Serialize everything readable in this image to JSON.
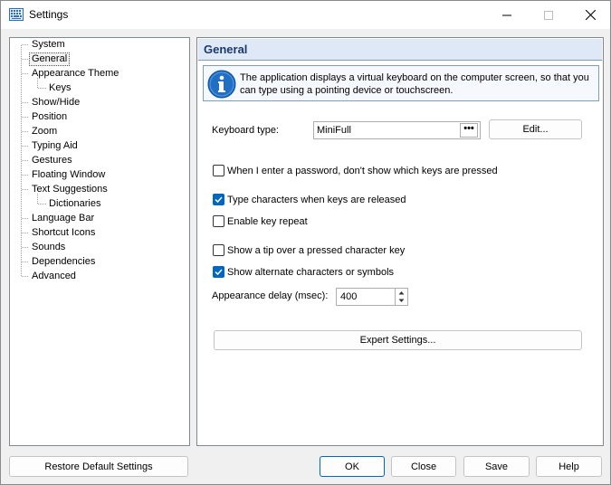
{
  "window": {
    "title": "Settings",
    "icon": "keyboard-icon"
  },
  "tree": {
    "items": [
      {
        "label": "System",
        "level": 0
      },
      {
        "label": "General",
        "level": 0,
        "selected": true
      },
      {
        "label": "Appearance Theme",
        "level": 0
      },
      {
        "label": "Keys",
        "level": 1
      },
      {
        "label": "Show/Hide",
        "level": 0
      },
      {
        "label": "Position",
        "level": 0
      },
      {
        "label": "Zoom",
        "level": 0
      },
      {
        "label": "Typing Aid",
        "level": 0
      },
      {
        "label": "Gestures",
        "level": 0
      },
      {
        "label": "Floating Window",
        "level": 0
      },
      {
        "label": "Text Suggestions",
        "level": 0
      },
      {
        "label": "Dictionaries",
        "level": 1
      },
      {
        "label": "Language Bar",
        "level": 0
      },
      {
        "label": "Shortcut Icons",
        "level": 0
      },
      {
        "label": "Sounds",
        "level": 0
      },
      {
        "label": "Dependencies",
        "level": 0
      },
      {
        "label": "Advanced",
        "level": 0
      }
    ]
  },
  "panel": {
    "title": "General",
    "info": "The application displays a virtual keyboard on the computer screen, so that you can type using a pointing device or touchscreen.",
    "keyboard_type_label": "Keyboard type:",
    "keyboard_type_value": "MiniFull",
    "dots_label": "•••",
    "edit_label": "Edit...",
    "options": [
      {
        "label": "When I enter a password, don't show which keys are pressed",
        "checked": false
      },
      {
        "label": "Type characters when keys are released",
        "checked": true
      },
      {
        "label": "Enable key repeat",
        "checked": false
      },
      {
        "label": "Show a tip over a pressed character key",
        "checked": false
      },
      {
        "label": "Show alternate characters or symbols",
        "checked": true
      }
    ],
    "delay_label": "Appearance delay (msec):",
    "delay_value": "400",
    "expert_label": "Expert Settings..."
  },
  "footer": {
    "restore_label": "Restore Default Settings",
    "ok_label": "OK",
    "close_label": "Close",
    "save_label": "Save",
    "help_label": "Help"
  },
  "colors": {
    "accent": "#0067c0",
    "header_bg": "#dfe8f6",
    "info_icon": "#1f6fc5"
  }
}
